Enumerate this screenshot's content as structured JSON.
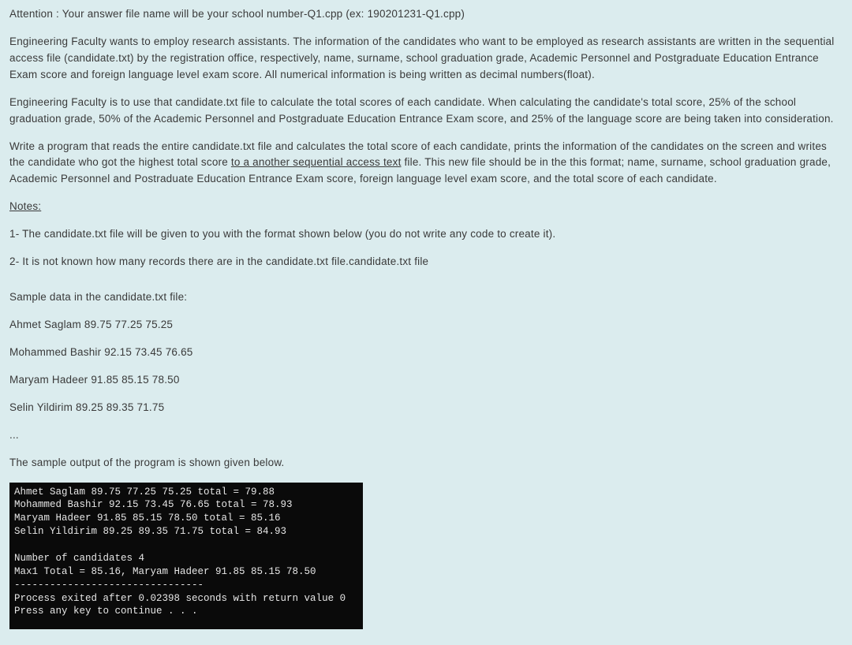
{
  "attention": "Attention : Your answer file name will be your school number-Q1.cpp (ex: 190201231-Q1.cpp)",
  "para1": "Engineering Faculty wants to employ research assistants. The information of the candidates who want to be employed as research assistants are written in the sequential access file (candidate.txt) by the registration office, respectively, name, surname, school graduation grade, Academic Personnel and Postgraduate Education Entrance Exam score and foreign language level exam score. All numerical information is being written as decimal numbers(float).",
  "para2": "Engineering Faculty is to use that candidate.txt file to calculate the total scores of each candidate.  When calculating the candidate's total score, 25% of the school graduation grade, 50% of the Academic Personnel and Postgraduate Education Entrance Exam score, and 25% of the language score are being taken into consideration.",
  "para3a": "Write a program that reads the entire candidate.txt file and calculates the total score of each candidate, prints the information of the candidates on the screen and writes the candidate who got the highest total score ",
  "para3_underlined": "to a another sequential access text",
  "para3b": " file. This new file should be in the this format; name, surname, school graduation grade, Academic Personnel and Postraduate Education Entrance Exam score, foreign language level exam score, and the total score of each candidate.",
  "notes_label": "Notes:",
  "note1": "1- The candidate.txt file will be given to you with the format shown below (you do not write any code to create it).",
  "note2": "2- It is not known how many records there are in the candidate.txt file.candidate.txt file",
  "sample_label": "Sample data in the candidate.txt file:",
  "sample_lines": [
    "Ahmet Saglam  89.75  77.25  75.25",
    "Mohammed Bashir  92.15  73.45  76.65",
    "Maryam Hadeer  91.85  85.15  78.50",
    "Selin Yildirim  89.25  89.35  71.75",
    "..."
  ],
  "output_label": "The sample output of the program is shown given below.",
  "console_text": "Ahmet Saglam 89.75 77.25 75.25 total = 79.88\nMohammed Bashir 92.15 73.45 76.65 total = 78.93\nMaryam Hadeer 91.85 85.15 78.50 total = 85.16\nSelin Yildirim 89.25 89.35 71.75 total = 84.93\n\nNumber of candidates 4\nMax1 Total = 85.16, Maryam Hadeer 91.85 85.15 78.50\n--------------------------------\nProcess exited after 0.02398 seconds with return value 0\nPress any key to continue . . ."
}
